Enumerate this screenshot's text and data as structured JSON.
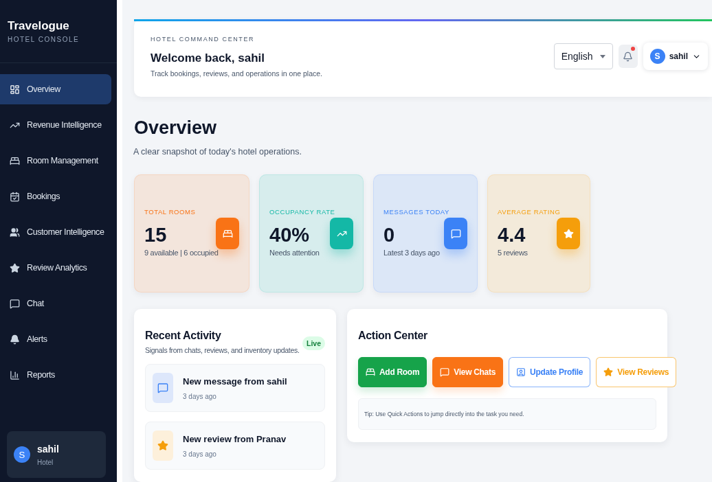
{
  "sidebar": {
    "brand": "Travelogue",
    "subtitle": "HOTEL CONSOLE",
    "items": [
      {
        "label": "Overview",
        "selected": true
      },
      {
        "label": "Revenue Intelligence",
        "selected": false
      },
      {
        "label": "Room Management",
        "selected": false
      },
      {
        "label": "Bookings",
        "selected": false
      },
      {
        "label": "Customer Intelligence",
        "selected": false
      },
      {
        "label": "Review Analytics",
        "selected": false
      },
      {
        "label": "Chat",
        "selected": false
      },
      {
        "label": "Alerts",
        "selected": false
      },
      {
        "label": "Reports",
        "selected": false
      }
    ],
    "user": {
      "initial": "S",
      "name": "sahil",
      "role": "Hotel"
    }
  },
  "header": {
    "eyebrow": "HOTEL COMMAND CENTER",
    "title": "Welcome back, sahil",
    "subtitle": "Track bookings, reviews, and operations in one place.",
    "language": "English",
    "has_notification": true,
    "user": {
      "initial": "S",
      "name": "sahil"
    }
  },
  "page": {
    "title": "Overview",
    "subtitle": "A clear snapshot of today's hotel operations."
  },
  "stats": [
    {
      "label": "TOTAL ROOMS",
      "value": "15",
      "note": "9 available | 6 occupied",
      "color": "#f97316"
    },
    {
      "label": "OCCUPANCY RATE",
      "value": "40%",
      "note": "Needs attention",
      "color": "#14b8a6"
    },
    {
      "label": "MESSAGES TODAY",
      "value": "0",
      "note": "Latest 3 days ago",
      "color": "#3b82f6"
    },
    {
      "label": "AVERAGE RATING",
      "value": "4.4",
      "note": "5 reviews",
      "color": "#f59e0b"
    }
  ],
  "recent_activity": {
    "title": "Recent Activity",
    "subtitle": "Signals from chats, reviews, and inventory updates.",
    "badge": "Live",
    "items": [
      {
        "kind": "message",
        "title": "New message from sahil",
        "time": "3 days ago"
      },
      {
        "kind": "review",
        "title": "New review from Pranav",
        "time": "3 days ago"
      }
    ]
  },
  "action_center": {
    "title": "Action Center",
    "actions": [
      {
        "label": "Add Room",
        "kind": "filled",
        "color": "#16a34a"
      },
      {
        "label": "View Chats",
        "kind": "filled",
        "color": "#f97316"
      },
      {
        "label": "Update Profile",
        "kind": "outline",
        "color": "#3b82f6"
      },
      {
        "label": "View Reviews",
        "kind": "outline",
        "color": "#f59e0b"
      }
    ],
    "tip": "Tip: Use Quick Actions to jump directly into the task you need."
  }
}
